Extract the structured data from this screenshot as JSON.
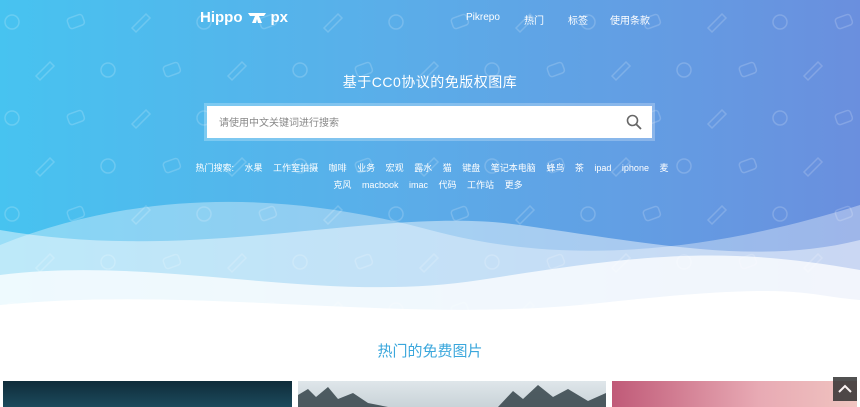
{
  "nav": {
    "logo": "Hippo px",
    "logo_left": "Hippo",
    "logo_right": "px",
    "links": [
      "Pikrepo",
      "热门",
      "标签",
      "使用条款"
    ]
  },
  "hero": {
    "title": "基于CC0协议的免版权图库",
    "search_placeholder": "请使用中文关键词进行搜索",
    "hot_label": "热门搜索:",
    "hot_keywords": [
      "水果",
      "工作室拍摄",
      "咖啡",
      "业务",
      "宏观",
      "露水",
      "猫",
      "键盘",
      "笔记本电脑",
      "蜂鸟",
      "茶",
      "ipad",
      "iphone",
      "麦克风",
      "macbook",
      "imac",
      "代码",
      "工作站",
      "更多"
    ]
  },
  "section": {
    "title": "热门的免费图片"
  },
  "colors": {
    "accent": "#3ba7dc",
    "gradient_start": "#47c3f0",
    "gradient_end": "#6a8fde"
  },
  "icons": [
    "search-icon",
    "logo-icon",
    "back-to-top-icon"
  ]
}
